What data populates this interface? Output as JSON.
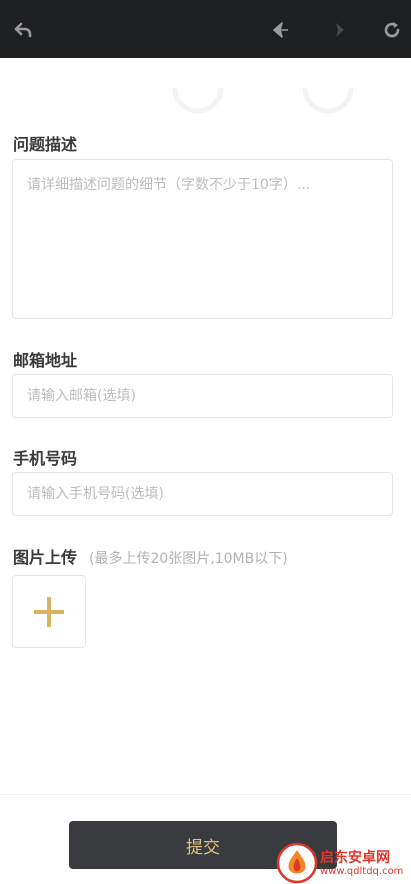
{
  "toolbar": {
    "back_icon": "back-arrow-icon",
    "prev_icon": "diamond-left-icon",
    "next_icon": "diamond-right-icon",
    "refresh_icon": "refresh-icon"
  },
  "form": {
    "description": {
      "label": "问题描述",
      "placeholder": "请详细描述问题的细节（字数不少于10字）..."
    },
    "email": {
      "label": "邮箱地址",
      "placeholder": "请输入邮箱(选填)"
    },
    "phone": {
      "label": "手机号码",
      "placeholder": "请输入手机号码(选填)"
    },
    "images": {
      "label": "图片上传",
      "hint": "(最多上传20张图片,10MB以下)",
      "add_icon": "plus-icon"
    }
  },
  "submit": {
    "label": "提交"
  },
  "watermark": {
    "title": "启东安卓网",
    "url": "www.qdltdq.com"
  },
  "colors": {
    "topbar": "#1e1f21",
    "accent": "#e0c27a",
    "button_bg": "#3a3b3f"
  }
}
